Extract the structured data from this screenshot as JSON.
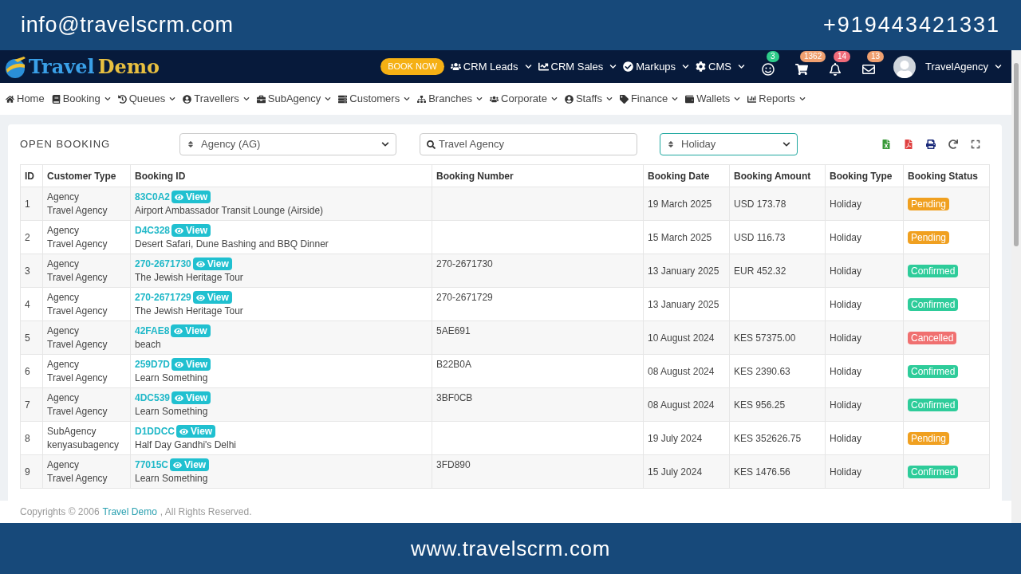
{
  "banner": {
    "email": "info@travelscrm.com",
    "phone": "+919443421331"
  },
  "header": {
    "logo": {
      "part1": "Travel",
      "part2": "Demo"
    },
    "book_now": "BOOK NOW",
    "menus": [
      {
        "label": "CRM Leads"
      },
      {
        "label": "CRM Sales"
      },
      {
        "label": "Markups"
      },
      {
        "label": "CMS"
      }
    ],
    "notifications": [
      {
        "count": "3",
        "color": "#2ecc8a"
      },
      {
        "count": "1362",
        "color": "#f0a070"
      },
      {
        "count": "14",
        "color": "#f06b7a"
      },
      {
        "count": "13",
        "color": "#f0a070"
      }
    ],
    "user": "TravelAgency"
  },
  "nav": [
    {
      "label": "Home",
      "dropdown": false
    },
    {
      "label": "Booking",
      "dropdown": true
    },
    {
      "label": "Queues",
      "dropdown": true
    },
    {
      "label": "Travellers",
      "dropdown": true
    },
    {
      "label": "SubAgency",
      "dropdown": true
    },
    {
      "label": "Customers",
      "dropdown": true
    },
    {
      "label": "Branches",
      "dropdown": true
    },
    {
      "label": "Corporate",
      "dropdown": true
    },
    {
      "label": "Staffs",
      "dropdown": true
    },
    {
      "label": "Finance",
      "dropdown": true
    },
    {
      "label": "Wallets",
      "dropdown": true
    },
    {
      "label": "Reports",
      "dropdown": true
    }
  ],
  "panel": {
    "title": "OPEN BOOKING",
    "agency_select": "Agency (AG)",
    "search_value": "Travel Agency",
    "type_select": "Holiday"
  },
  "table": {
    "columns": [
      "ID",
      "Customer Type",
      "Booking ID",
      "Booking Number",
      "Booking Date",
      "Booking Amount",
      "Booking Type",
      "Booking Status"
    ],
    "rows": [
      {
        "id": "1",
        "customer_type": "Agency",
        "customer": "Travel Agency",
        "booking_id": "83C0A2",
        "view": "View",
        "title": "Airport Ambassador Transit Lounge (Airside)",
        "number": "",
        "date": "19 March 2025",
        "amount": "USD 173.78",
        "type": "Holiday",
        "status": "Pending",
        "color": "#f0a020"
      },
      {
        "id": "2",
        "customer_type": "Agency",
        "customer": "Travel Agency",
        "booking_id": "D4C328",
        "view": "View",
        "title": "Desert Safari, Dune Bashing and BBQ Dinner",
        "number": "",
        "date": "15 March 2025",
        "amount": "USD 116.73",
        "type": "Holiday",
        "status": "Pending",
        "color": "#f0a020"
      },
      {
        "id": "3",
        "customer_type": "Agency",
        "customer": "Travel Agency",
        "booking_id": "270-2671730",
        "view": "View",
        "title": "The Jewish Heritage Tour",
        "number": "270-2671730",
        "date": "13 January 2025",
        "amount": "EUR 452.32",
        "type": "Holiday",
        "status": "Confirmed",
        "color": "#2ecc9a"
      },
      {
        "id": "4",
        "customer_type": "Agency",
        "customer": "Travel Agency",
        "booking_id": "270-2671729",
        "view": "View",
        "title": "The Jewish Heritage Tour",
        "number": "270-2671729",
        "date": "13 January 2025",
        "amount": "",
        "type": "Holiday",
        "status": "Confirmed",
        "color": "#2ecc9a"
      },
      {
        "id": "5",
        "customer_type": "Agency",
        "customer": "Travel Agency",
        "booking_id": "42FAE8",
        "view": "View",
        "title": "beach",
        "number": "5AE691",
        "date": "10 August 2024",
        "amount": "KES 57375.00",
        "type": "Holiday",
        "status": "Cancelled",
        "color": "#f07070"
      },
      {
        "id": "6",
        "customer_type": "Agency",
        "customer": "Travel Agency",
        "booking_id": "259D7D",
        "view": "View",
        "title": "Learn Something",
        "number": "B22B0A",
        "date": "08 August 2024",
        "amount": "KES 2390.63",
        "type": "Holiday",
        "status": "Confirmed",
        "color": "#2ecc9a"
      },
      {
        "id": "7",
        "customer_type": "Agency",
        "customer": "Travel Agency",
        "booking_id": "4DC539",
        "view": "View",
        "title": "Learn Something",
        "number": "3BF0CB",
        "date": "08 August 2024",
        "amount": "KES 956.25",
        "type": "Holiday",
        "status": "Confirmed",
        "color": "#2ecc9a"
      },
      {
        "id": "8",
        "customer_type": "SubAgency",
        "customer": "kenyasubagency",
        "booking_id": "D1DDCC",
        "view": "View",
        "title": "Half Day Gandhi's Delhi",
        "number": "",
        "date": "19 July 2024",
        "amount": "KES 352626.75",
        "type": "Holiday",
        "status": "Pending",
        "color": "#f0a020"
      },
      {
        "id": "9",
        "customer_type": "Agency",
        "customer": "Travel Agency",
        "booking_id": "77015C",
        "view": "View",
        "title": "Learn Something",
        "number": "3FD890",
        "date": "15 July 2024",
        "amount": "KES 1476.56",
        "type": "Holiday",
        "status": "Confirmed",
        "color": "#2ecc9a"
      }
    ]
  },
  "footer": {
    "prefix": "Copyrights © 2006",
    "link": "Travel Demo",
    "suffix": ", All Rights Reserved."
  },
  "website": "www.travelscrm.com"
}
